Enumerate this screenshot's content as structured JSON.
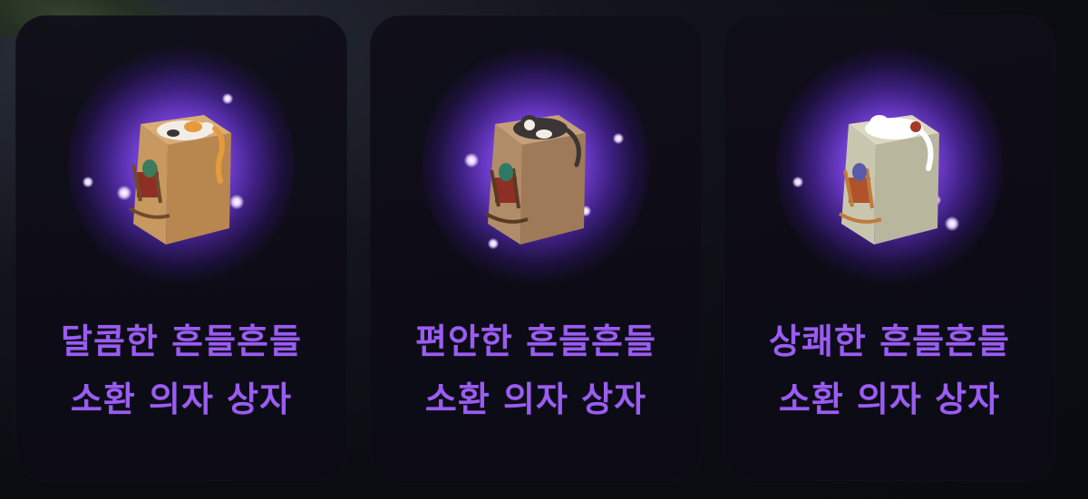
{
  "cards": [
    {
      "line1": "달콤한 흔들흔들",
      "line2": "소환 의자 상자",
      "box_color": "#c79b62",
      "cat_color": "#f2eee7",
      "icon": "calico-cat-chair-box-icon"
    },
    {
      "line1": "편안한 흔들흔들",
      "line2": "소환 의자 상자",
      "box_color": "#b08c68",
      "cat_color": "#3b3536",
      "icon": "tuxedo-cat-chair-box-icon"
    },
    {
      "line1": "상쾌한 흔들흔들",
      "line2": "소환 의자 상자",
      "box_color": "#c9c6ae",
      "cat_color": "#ffffff",
      "icon": "white-cat-chair-box-icon"
    }
  ],
  "accent_color": "#9a5cf2"
}
